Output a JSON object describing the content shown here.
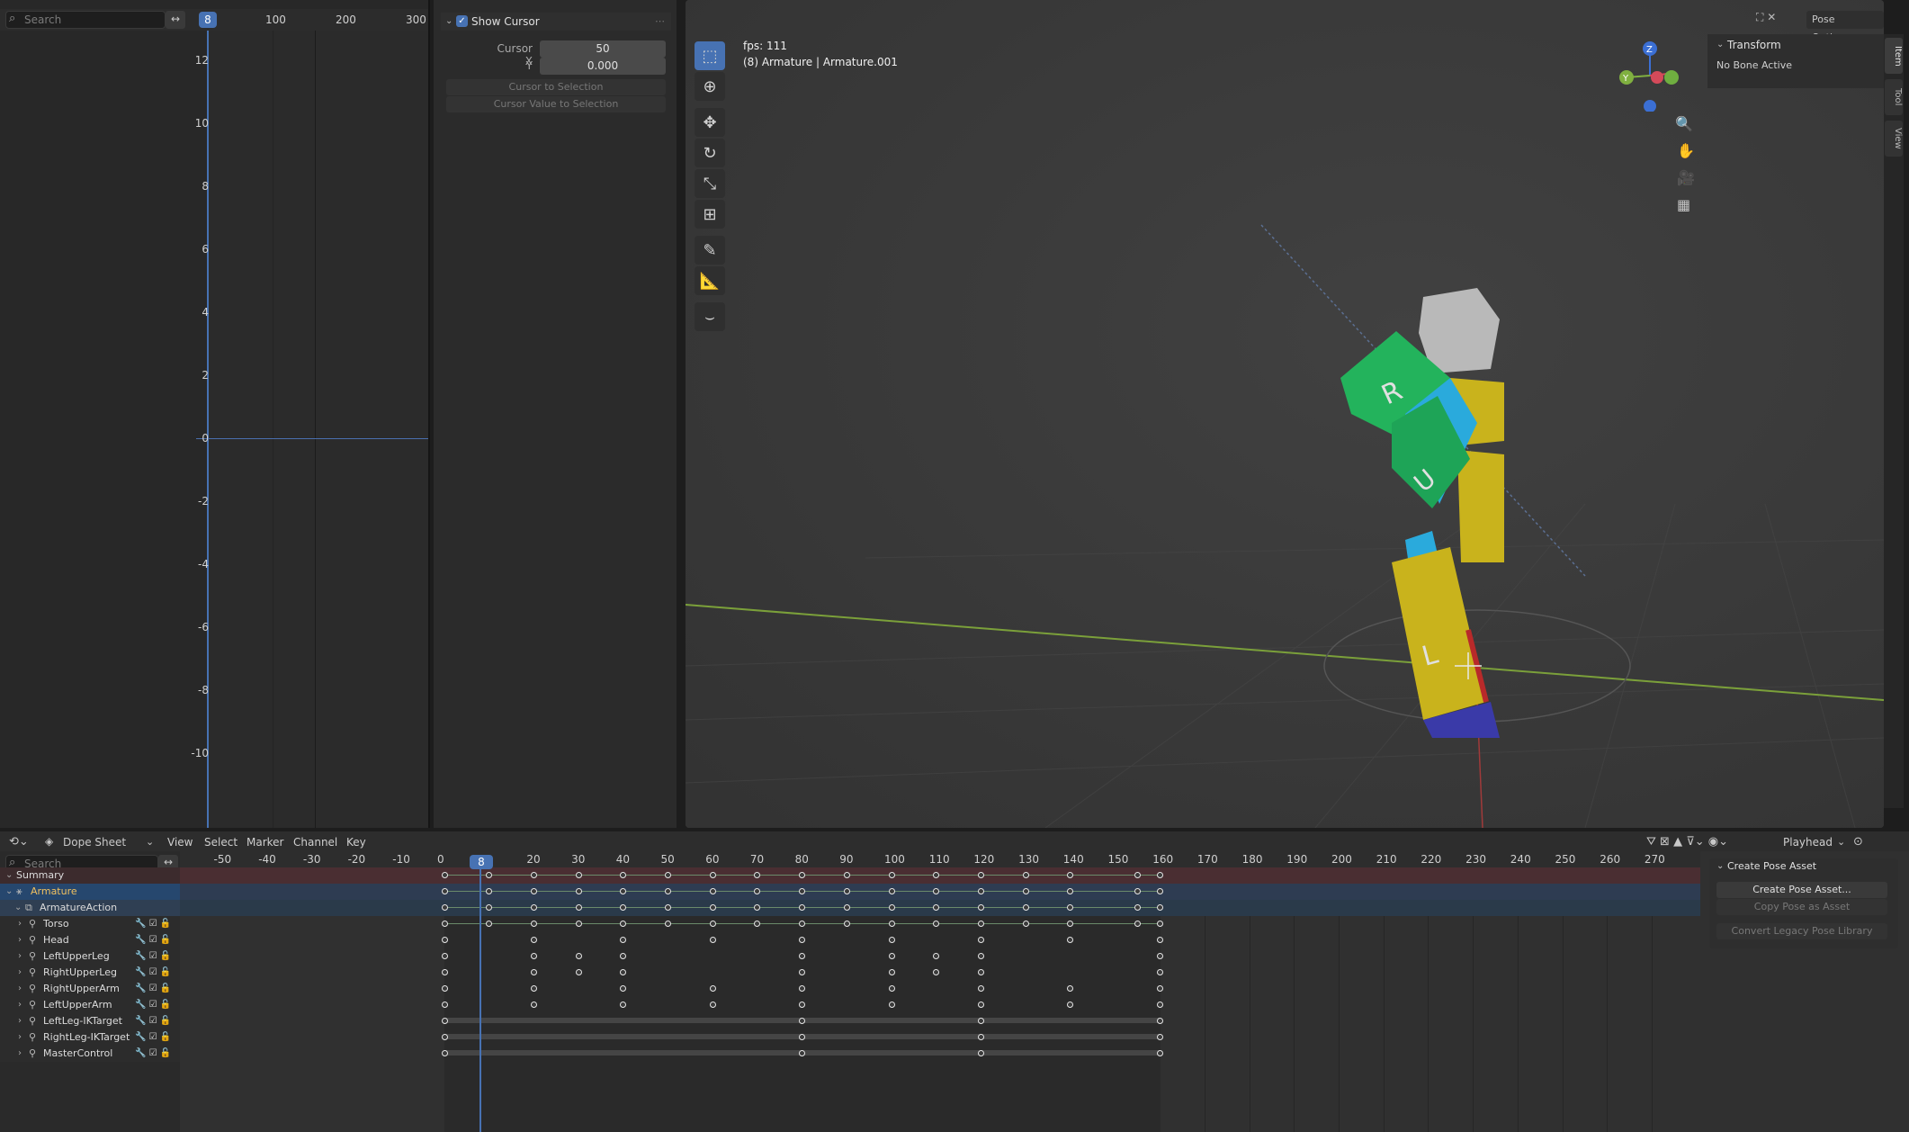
{
  "graph_editor": {
    "search_placeholder": "Search",
    "frame_indicator": "8",
    "x_ticks": [
      "100",
      "200",
      "300"
    ],
    "y_ticks": [
      "12",
      "10",
      "8",
      "6",
      "4",
      "2",
      "0",
      "-2",
      "-4",
      "-6",
      "-8",
      "-10"
    ]
  },
  "cursor_panel": {
    "header": "Show Cursor",
    "cursor_x_label": "Cursor X",
    "cursor_x_value": "50",
    "y_label": "Y",
    "y_value": "0.000",
    "btn_cursor_to_selection": "Cursor to Selection",
    "btn_cursor_value_to_selection": "Cursor Value to Selection"
  },
  "viewport": {
    "fps": "fps: 111",
    "object_info": "(8) Armature | Armature.001",
    "pose_options": "Pose Options",
    "transform_header": "Transform",
    "no_bone": "No Bone Active",
    "tabs": [
      "Item",
      "Tool",
      "View"
    ]
  },
  "dope_sheet": {
    "mode": "Dope Sheet",
    "menus": [
      "View",
      "Select",
      "Marker",
      "Channel",
      "Key"
    ],
    "playhead_label": "Playhead",
    "search_placeholder": "Search",
    "current_frame": "8",
    "ruler": [
      "-50",
      "-40",
      "-30",
      "-20",
      "-10",
      "0",
      "",
      "20",
      "30",
      "40",
      "50",
      "60",
      "70",
      "80",
      "90",
      "100",
      "110",
      "120",
      "130",
      "140",
      "150",
      "160",
      "170",
      "180",
      "190",
      "200",
      "210",
      "220",
      "230",
      "240",
      "250",
      "260",
      "270"
    ],
    "channels": [
      {
        "name": "Summary",
        "type": "summary"
      },
      {
        "name": "Armature",
        "type": "object"
      },
      {
        "name": "ArmatureAction",
        "type": "action"
      },
      {
        "name": "Torso",
        "type": "bone"
      },
      {
        "name": "Head",
        "type": "bone"
      },
      {
        "name": "LeftUpperLeg",
        "type": "bone"
      },
      {
        "name": "RightUpperLeg",
        "type": "bone"
      },
      {
        "name": "RightUpperArm",
        "type": "bone"
      },
      {
        "name": "LeftUpperArm",
        "type": "bone"
      },
      {
        "name": "LeftLeg-IKTarget",
        "type": "bone"
      },
      {
        "name": "RightLeg-IKTarget",
        "type": "bone"
      },
      {
        "name": "MasterControl",
        "type": "bone"
      }
    ],
    "keyframes": [
      [
        0,
        10,
        20,
        30,
        40,
        50,
        60,
        70,
        80,
        90,
        100,
        110,
        120,
        130,
        140,
        155,
        160
      ],
      [
        0,
        10,
        20,
        30,
        40,
        50,
        60,
        70,
        80,
        90,
        100,
        110,
        120,
        130,
        140,
        155,
        160
      ],
      [
        0,
        10,
        20,
        30,
        40,
        50,
        60,
        70,
        80,
        90,
        100,
        110,
        120,
        130,
        140,
        155,
        160
      ],
      [
        0,
        10,
        20,
        30,
        40,
        50,
        60,
        70,
        80,
        90,
        100,
        110,
        120,
        130,
        140,
        155,
        160
      ],
      [
        0,
        20,
        40,
        60,
        80,
        100,
        120,
        140,
        160
      ],
      [
        0,
        20,
        30,
        40,
        80,
        100,
        110,
        120,
        160
      ],
      [
        0,
        20,
        30,
        40,
        80,
        100,
        110,
        120,
        160
      ],
      [
        0,
        20,
        40,
        60,
        80,
        100,
        120,
        140,
        160
      ],
      [
        0,
        20,
        40,
        60,
        80,
        100,
        120,
        140,
        160
      ],
      [
        0,
        80,
        120,
        160
      ],
      [
        0,
        80,
        120,
        160
      ],
      [
        0,
        80,
        120,
        160
      ]
    ],
    "pose_panel": {
      "header": "Create Pose Asset",
      "create_btn": "Create Pose Asset...",
      "copy_btn": "Copy Pose as Asset",
      "convert_btn": "Convert Legacy Pose Library"
    }
  }
}
